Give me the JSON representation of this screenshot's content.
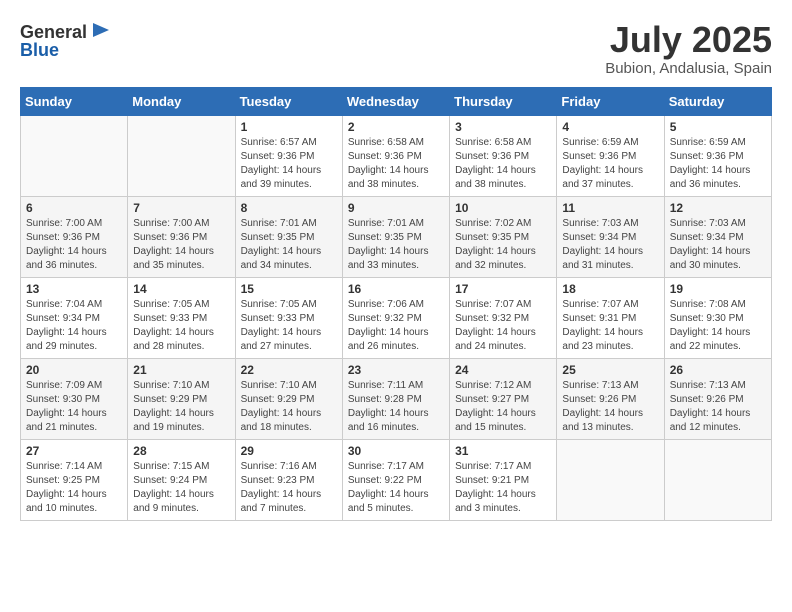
{
  "header": {
    "logo_general": "General",
    "logo_blue": "Blue",
    "month_year": "July 2025",
    "location": "Bubion, Andalusia, Spain"
  },
  "days_of_week": [
    "Sunday",
    "Monday",
    "Tuesday",
    "Wednesday",
    "Thursday",
    "Friday",
    "Saturday"
  ],
  "weeks": [
    [
      {
        "day": "",
        "sunrise": "",
        "sunset": "",
        "daylight": ""
      },
      {
        "day": "",
        "sunrise": "",
        "sunset": "",
        "daylight": ""
      },
      {
        "day": "1",
        "sunrise": "Sunrise: 6:57 AM",
        "sunset": "Sunset: 9:36 PM",
        "daylight": "Daylight: 14 hours and 39 minutes."
      },
      {
        "day": "2",
        "sunrise": "Sunrise: 6:58 AM",
        "sunset": "Sunset: 9:36 PM",
        "daylight": "Daylight: 14 hours and 38 minutes."
      },
      {
        "day": "3",
        "sunrise": "Sunrise: 6:58 AM",
        "sunset": "Sunset: 9:36 PM",
        "daylight": "Daylight: 14 hours and 38 minutes."
      },
      {
        "day": "4",
        "sunrise": "Sunrise: 6:59 AM",
        "sunset": "Sunset: 9:36 PM",
        "daylight": "Daylight: 14 hours and 37 minutes."
      },
      {
        "day": "5",
        "sunrise": "Sunrise: 6:59 AM",
        "sunset": "Sunset: 9:36 PM",
        "daylight": "Daylight: 14 hours and 36 minutes."
      }
    ],
    [
      {
        "day": "6",
        "sunrise": "Sunrise: 7:00 AM",
        "sunset": "Sunset: 9:36 PM",
        "daylight": "Daylight: 14 hours and 36 minutes."
      },
      {
        "day": "7",
        "sunrise": "Sunrise: 7:00 AM",
        "sunset": "Sunset: 9:36 PM",
        "daylight": "Daylight: 14 hours and 35 minutes."
      },
      {
        "day": "8",
        "sunrise": "Sunrise: 7:01 AM",
        "sunset": "Sunset: 9:35 PM",
        "daylight": "Daylight: 14 hours and 34 minutes."
      },
      {
        "day": "9",
        "sunrise": "Sunrise: 7:01 AM",
        "sunset": "Sunset: 9:35 PM",
        "daylight": "Daylight: 14 hours and 33 minutes."
      },
      {
        "day": "10",
        "sunrise": "Sunrise: 7:02 AM",
        "sunset": "Sunset: 9:35 PM",
        "daylight": "Daylight: 14 hours and 32 minutes."
      },
      {
        "day": "11",
        "sunrise": "Sunrise: 7:03 AM",
        "sunset": "Sunset: 9:34 PM",
        "daylight": "Daylight: 14 hours and 31 minutes."
      },
      {
        "day": "12",
        "sunrise": "Sunrise: 7:03 AM",
        "sunset": "Sunset: 9:34 PM",
        "daylight": "Daylight: 14 hours and 30 minutes."
      }
    ],
    [
      {
        "day": "13",
        "sunrise": "Sunrise: 7:04 AM",
        "sunset": "Sunset: 9:34 PM",
        "daylight": "Daylight: 14 hours and 29 minutes."
      },
      {
        "day": "14",
        "sunrise": "Sunrise: 7:05 AM",
        "sunset": "Sunset: 9:33 PM",
        "daylight": "Daylight: 14 hours and 28 minutes."
      },
      {
        "day": "15",
        "sunrise": "Sunrise: 7:05 AM",
        "sunset": "Sunset: 9:33 PM",
        "daylight": "Daylight: 14 hours and 27 minutes."
      },
      {
        "day": "16",
        "sunrise": "Sunrise: 7:06 AM",
        "sunset": "Sunset: 9:32 PM",
        "daylight": "Daylight: 14 hours and 26 minutes."
      },
      {
        "day": "17",
        "sunrise": "Sunrise: 7:07 AM",
        "sunset": "Sunset: 9:32 PM",
        "daylight": "Daylight: 14 hours and 24 minutes."
      },
      {
        "day": "18",
        "sunrise": "Sunrise: 7:07 AM",
        "sunset": "Sunset: 9:31 PM",
        "daylight": "Daylight: 14 hours and 23 minutes."
      },
      {
        "day": "19",
        "sunrise": "Sunrise: 7:08 AM",
        "sunset": "Sunset: 9:30 PM",
        "daylight": "Daylight: 14 hours and 22 minutes."
      }
    ],
    [
      {
        "day": "20",
        "sunrise": "Sunrise: 7:09 AM",
        "sunset": "Sunset: 9:30 PM",
        "daylight": "Daylight: 14 hours and 21 minutes."
      },
      {
        "day": "21",
        "sunrise": "Sunrise: 7:10 AM",
        "sunset": "Sunset: 9:29 PM",
        "daylight": "Daylight: 14 hours and 19 minutes."
      },
      {
        "day": "22",
        "sunrise": "Sunrise: 7:10 AM",
        "sunset": "Sunset: 9:29 PM",
        "daylight": "Daylight: 14 hours and 18 minutes."
      },
      {
        "day": "23",
        "sunrise": "Sunrise: 7:11 AM",
        "sunset": "Sunset: 9:28 PM",
        "daylight": "Daylight: 14 hours and 16 minutes."
      },
      {
        "day": "24",
        "sunrise": "Sunrise: 7:12 AM",
        "sunset": "Sunset: 9:27 PM",
        "daylight": "Daylight: 14 hours and 15 minutes."
      },
      {
        "day": "25",
        "sunrise": "Sunrise: 7:13 AM",
        "sunset": "Sunset: 9:26 PM",
        "daylight": "Daylight: 14 hours and 13 minutes."
      },
      {
        "day": "26",
        "sunrise": "Sunrise: 7:13 AM",
        "sunset": "Sunset: 9:26 PM",
        "daylight": "Daylight: 14 hours and 12 minutes."
      }
    ],
    [
      {
        "day": "27",
        "sunrise": "Sunrise: 7:14 AM",
        "sunset": "Sunset: 9:25 PM",
        "daylight": "Daylight: 14 hours and 10 minutes."
      },
      {
        "day": "28",
        "sunrise": "Sunrise: 7:15 AM",
        "sunset": "Sunset: 9:24 PM",
        "daylight": "Daylight: 14 hours and 9 minutes."
      },
      {
        "day": "29",
        "sunrise": "Sunrise: 7:16 AM",
        "sunset": "Sunset: 9:23 PM",
        "daylight": "Daylight: 14 hours and 7 minutes."
      },
      {
        "day": "30",
        "sunrise": "Sunrise: 7:17 AM",
        "sunset": "Sunset: 9:22 PM",
        "daylight": "Daylight: 14 hours and 5 minutes."
      },
      {
        "day": "31",
        "sunrise": "Sunrise: 7:17 AM",
        "sunset": "Sunset: 9:21 PM",
        "daylight": "Daylight: 14 hours and 3 minutes."
      },
      {
        "day": "",
        "sunrise": "",
        "sunset": "",
        "daylight": ""
      },
      {
        "day": "",
        "sunrise": "",
        "sunset": "",
        "daylight": ""
      }
    ]
  ]
}
